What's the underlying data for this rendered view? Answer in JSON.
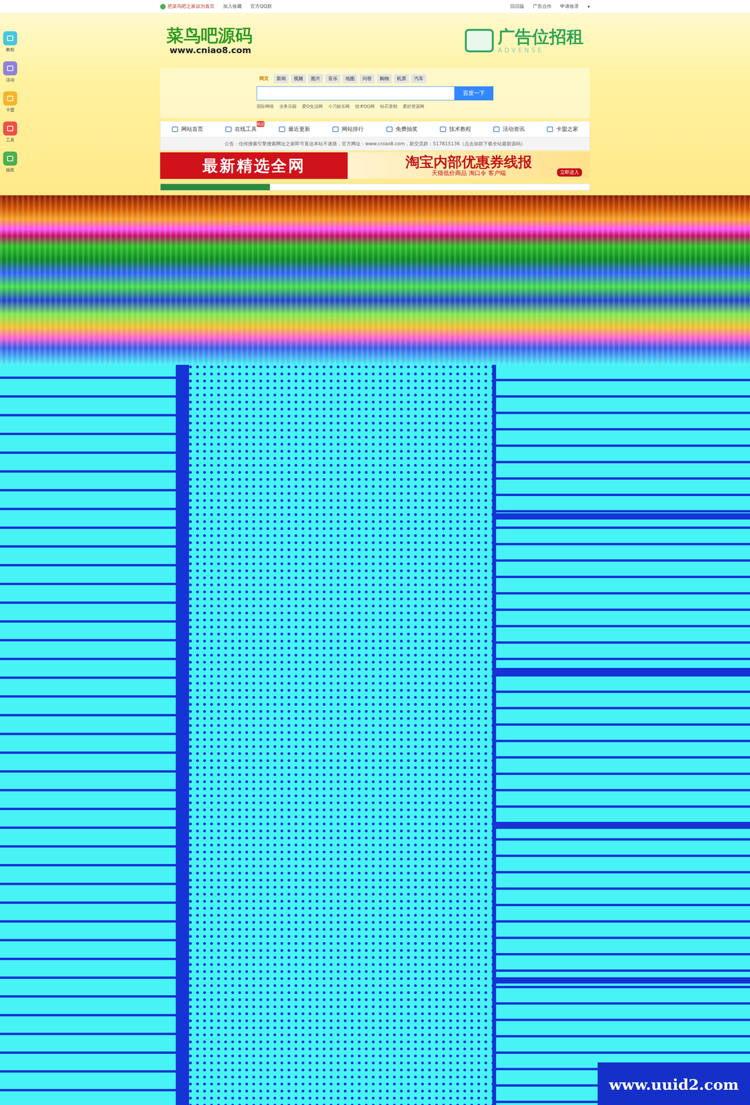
{
  "topbar": {
    "left": [
      "把菜鸟吧之家设为首页",
      "加入收藏",
      "官方QQ群"
    ],
    "right": [
      "回旧版",
      "广告合作",
      "申请收录"
    ],
    "menu": "▾"
  },
  "sidebar": {
    "items": [
      {
        "label": "教程",
        "color": "#49c6dc"
      },
      {
        "label": "活动",
        "color": "#8f83d8"
      },
      {
        "label": "卡盟",
        "color": "#f4b52c"
      },
      {
        "label": "工具",
        "color": "#ee5246"
      },
      {
        "label": "抽奖",
        "color": "#4caf50"
      }
    ]
  },
  "logo": {
    "name": "菜鸟吧源码",
    "url": "www.cniao8.com"
  },
  "ad": {
    "title": "广告位招租",
    "sub": "ADVENSE"
  },
  "search": {
    "tabs": [
      {
        "label": "网页",
        "selected": true
      },
      {
        "label": "新闻",
        "selected": false
      },
      {
        "label": "视频",
        "selected": false
      },
      {
        "label": "图片",
        "selected": false
      },
      {
        "label": "音乐",
        "selected": false
      },
      {
        "label": "地图",
        "selected": false
      },
      {
        "label": "问答",
        "selected": false
      },
      {
        "label": "购物",
        "selected": false
      },
      {
        "label": "机票",
        "selected": false
      },
      {
        "label": "汽车",
        "selected": false
      }
    ],
    "button": "百度一下",
    "links": [
      "国际网络",
      "业务乐园",
      "爱Q生活网",
      "小刀娱乐网",
      "技术QQ网",
      "钻石皇朝",
      "爱好资源网"
    ]
  },
  "nav": {
    "items": [
      {
        "label": "网站首页",
        "badge": ""
      },
      {
        "label": "在线工具",
        "badge": "精品"
      },
      {
        "label": "最近更新",
        "badge": ""
      },
      {
        "label": "网站排行",
        "badge": ""
      },
      {
        "label": "免费抽奖",
        "badge": ""
      },
      {
        "label": "技术教程",
        "badge": ""
      },
      {
        "label": "活动资讯",
        "badge": ""
      },
      {
        "label": "卡盟之家",
        "badge": ""
      }
    ]
  },
  "notice": "公告：任何搜索引擎搜索网址之家即可直达本站不迷路，官方网址：www.cniao8.com，新交流群：517815136（点击加群下载全站最新源码）",
  "banner": {
    "left": "最新精选全网",
    "title": "淘宝内部优惠券线报",
    "sub": "天猫低价商品 淘口令 客户端",
    "cta": "立即进入"
  },
  "watermark": "www.uuid2.com"
}
